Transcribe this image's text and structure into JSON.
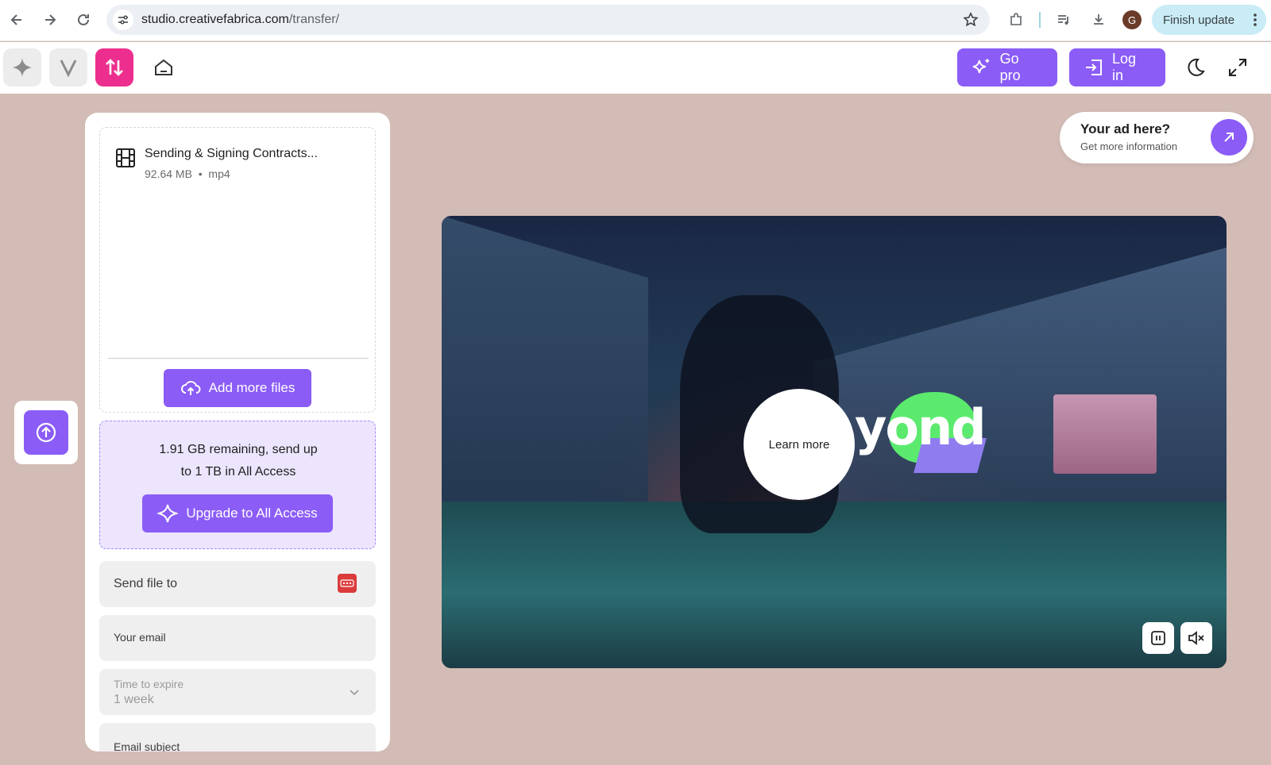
{
  "browser": {
    "url_host": "studio.creativefabrica.com",
    "url_path": "/transfer/",
    "avatar_letter": "G",
    "finish_update_label": "Finish update"
  },
  "appbar": {
    "go_pro_label": "Go pro",
    "login_label": "Log in"
  },
  "upload_panel": {
    "file": {
      "name": "Sending & Signing Contracts...",
      "size": "92.64 MB",
      "separator": "•",
      "type": "mp4"
    },
    "add_more_label": "Add more files",
    "quota_line1": "1.91 GB remaining, send up",
    "quota_line2": "to 1 TB in All Access",
    "upgrade_label": "Upgrade to All Access",
    "send_to_placeholder": "Send file to",
    "email_placeholder": "Your email",
    "expire_label": "Time to expire",
    "expire_value": "1 week",
    "subject_placeholder": "Email subject"
  },
  "ad": {
    "title": "Your ad here?",
    "subtitle": "Get more information"
  },
  "video": {
    "brand_word": "yond",
    "learn_more_label": "Learn more"
  },
  "colors": {
    "accent": "#8b5cf6",
    "pink": "#ec2f8e",
    "page_bg": "#d3bcb6"
  }
}
